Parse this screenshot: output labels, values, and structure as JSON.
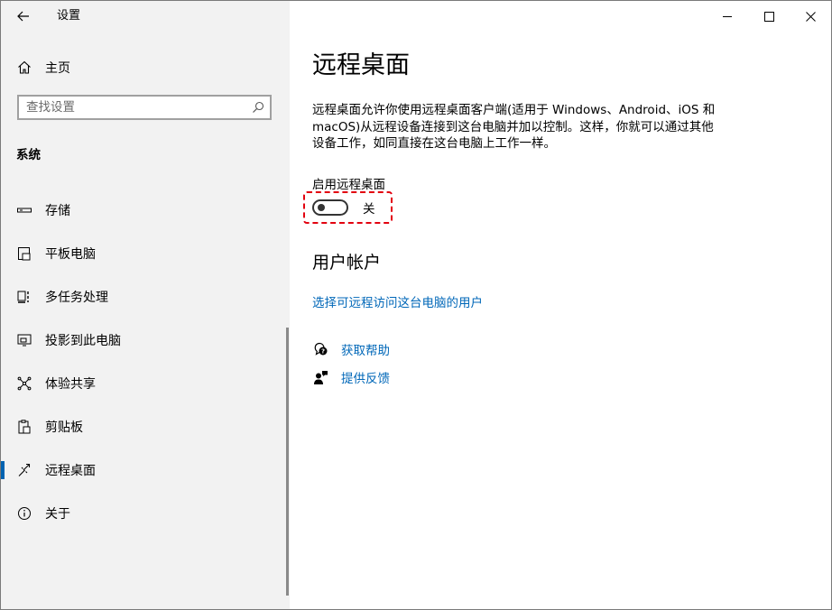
{
  "app": {
    "title": "设置"
  },
  "sidebar": {
    "home_label": "主页",
    "search_placeholder": "查找设置",
    "section_title": "系统",
    "items": [
      {
        "label": "存储",
        "icon": "storage-icon"
      },
      {
        "label": "平板电脑",
        "icon": "tablet-icon"
      },
      {
        "label": "多任务处理",
        "icon": "multitasking-icon"
      },
      {
        "label": "投影到此电脑",
        "icon": "projecting-icon"
      },
      {
        "label": "体验共享",
        "icon": "shared-experiences-icon"
      },
      {
        "label": "剪贴板",
        "icon": "clipboard-icon"
      },
      {
        "label": "远程桌面",
        "icon": "remote-desktop-icon",
        "selected": true
      },
      {
        "label": "关于",
        "icon": "info-icon"
      }
    ]
  },
  "main": {
    "title": "远程桌面",
    "description": "远程桌面允许你使用远程桌面客户端(适用于 Windows、Android、iOS 和 macOS)从远程设备连接到这台电脑并加以控制。这样，你就可以通过其他设备工作，如同直接在这台电脑上工作一样。",
    "toggle": {
      "label": "启用远程桌面",
      "state_text": "关",
      "on": false
    },
    "user_accounts": {
      "heading": "用户帐户",
      "link": "选择可远程访问这台电脑的用户"
    },
    "help": {
      "get_help": "获取帮助",
      "feedback": "提供反馈"
    }
  },
  "colors": {
    "accent": "#0063b1",
    "link": "#0067b8",
    "highlight": "#e2000f",
    "sidebar_bg": "#f2f2f2"
  }
}
